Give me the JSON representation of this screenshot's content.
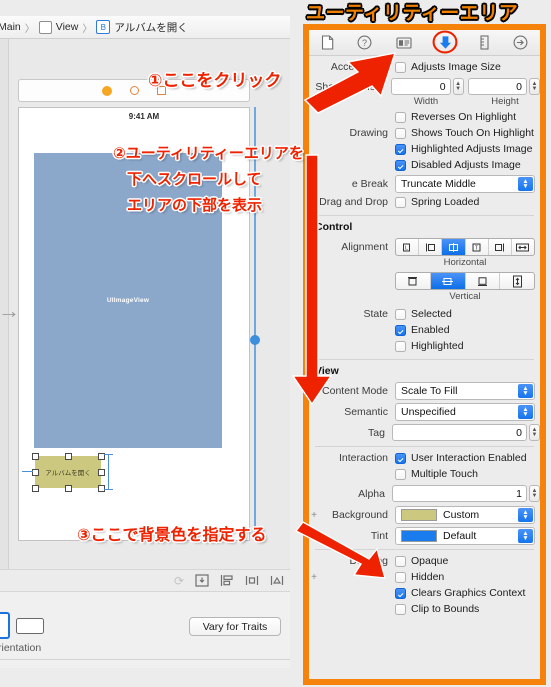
{
  "annotations": {
    "title": "ユーティリティーエリア",
    "step1": "①ここをクリック",
    "step2_line1": "②ユーティリティーエリアを",
    "step2_line2": "下へスクロールして",
    "step2_line3": "エリアの下部を表示",
    "step3": "③ここで背景色を指定する"
  },
  "breadcrumb": {
    "items": [
      "Main",
      "View",
      "アルバムを開く"
    ],
    "button_glyph": "B"
  },
  "canvas": {
    "status_time": "9:41 AM",
    "imageview_label": "UIImageView",
    "button_label": "アルバムを開く",
    "imageview_color": "#8ba7ca",
    "button_color": "#ccc87f"
  },
  "canvas_toolbar": {
    "icons": [
      "update-frames-icon",
      "embed-in-icon",
      "align-icon",
      "pin-icon",
      "resolve-auto-layout-issues-icon"
    ]
  },
  "device_bar": {
    "orientation_label": "rientation",
    "vary_button": "Vary for Traits"
  },
  "inspector": {
    "tabs": [
      {
        "name": "file-inspector-tab",
        "glyph": "file-icon",
        "selected": false
      },
      {
        "name": "quick-help-inspector-tab",
        "glyph": "question-circle-icon",
        "selected": false
      },
      {
        "name": "identity-inspector-tab",
        "glyph": "identity-card-icon",
        "selected": false
      },
      {
        "name": "attributes-inspector-tab",
        "glyph": "down-arrow-icon",
        "selected": true
      },
      {
        "name": "size-inspector-tab",
        "glyph": "ruler-icon",
        "selected": false
      },
      {
        "name": "connections-inspector-tab",
        "glyph": "arrow-circle-icon",
        "selected": false
      }
    ],
    "image_view_section": {
      "accessibility_label": "Accessibility",
      "adjusts_image_size": {
        "label": "Adjusts Image Size",
        "checked": false
      },
      "shadow_offset_label": "Shadow Offset",
      "shadow_width": {
        "value": "0",
        "caption": "Width"
      },
      "shadow_height": {
        "value": "0",
        "caption": "Height"
      },
      "drawing_label": "Drawing",
      "drawing_options": [
        {
          "label": "Reverses On Highlight",
          "checked": false
        },
        {
          "label": "Shows Touch On Highlight",
          "checked": false
        },
        {
          "label": "Highlighted Adjusts Image",
          "checked": true
        },
        {
          "label": "Disabled Adjusts Image",
          "checked": true
        }
      ],
      "line_break_label": "e Break",
      "line_break_value": "Truncate Middle",
      "drag_and_drop_label": "Drag and Drop",
      "spring_loaded": {
        "label": "Spring Loaded",
        "checked": false
      }
    },
    "control_section": {
      "title": "Control",
      "alignment_label": "Alignment",
      "horizontal_caption": "Horizontal",
      "horizontal_segments": [
        "L",
        "left",
        "center",
        "T",
        "right",
        "fill"
      ],
      "horizontal_selected": 2,
      "vertical_caption": "Vertical",
      "vertical_segments": [
        "top",
        "center",
        "bottom",
        "fill"
      ],
      "vertical_selected": 1,
      "state_label": "State",
      "state_options": [
        {
          "label": "Selected",
          "checked": false
        },
        {
          "label": "Enabled",
          "checked": true
        },
        {
          "label": "Highlighted",
          "checked": false
        }
      ]
    },
    "view_section": {
      "title": "View",
      "content_mode_label": "Content Mode",
      "content_mode_value": "Scale To Fill",
      "semantic_label": "Semantic",
      "semantic_value": "Unspecified",
      "tag_label": "Tag",
      "tag_value": "0",
      "interaction_label": "Interaction",
      "interaction_options": [
        {
          "label": "User Interaction Enabled",
          "checked": true
        },
        {
          "label": "Multiple Touch",
          "checked": false
        }
      ],
      "alpha_label": "Alpha",
      "alpha_value": "1",
      "background_label": "Background",
      "background_value": "Custom",
      "background_color": "#ccc87f",
      "tint_label": "Tint",
      "tint_value": "Default",
      "tint_color": "#1a7ced",
      "drawing_label": "Drawing",
      "drawing_options": [
        {
          "label": "Opaque",
          "checked": false
        },
        {
          "label": "Hidden",
          "checked": false
        },
        {
          "label": "Clears Graphics Context",
          "checked": true
        },
        {
          "label": "Clip to Bounds",
          "checked": false
        }
      ]
    }
  },
  "colors": {
    "highlight_border": "#f5820b",
    "annotation_red": "#ef2200",
    "accent_blue": "#1675ec"
  }
}
